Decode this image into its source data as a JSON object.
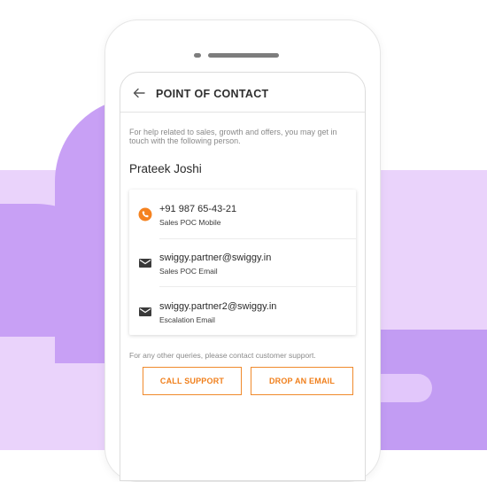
{
  "header": {
    "title": "POINT OF CONTACT",
    "back_icon": "arrow-left-icon"
  },
  "intro": {
    "help_text": "For help related to sales, growth and offers, you may get in touch with the following person."
  },
  "contact": {
    "name": "Prateek Joshi",
    "entries": [
      {
        "icon": "phone-icon",
        "value": "+91 987 65-43-21",
        "label": "Sales POC Mobile"
      },
      {
        "icon": "mail-icon",
        "value": "swiggy.partner@swiggy.in",
        "label": "Sales POC Email"
      },
      {
        "icon": "mail-icon",
        "value": "swiggy.partner2@swiggy.in",
        "label": "Escalation Email"
      }
    ]
  },
  "footer": {
    "other_text": "For any other queries, please contact customer support.",
    "call_support_label": "CALL SUPPORT",
    "drop_email_label": "DROP AN EMAIL"
  },
  "colors": {
    "accent": "#f07f1b",
    "purple": "#c8a0f5",
    "light_purple": "#ead3fb"
  }
}
